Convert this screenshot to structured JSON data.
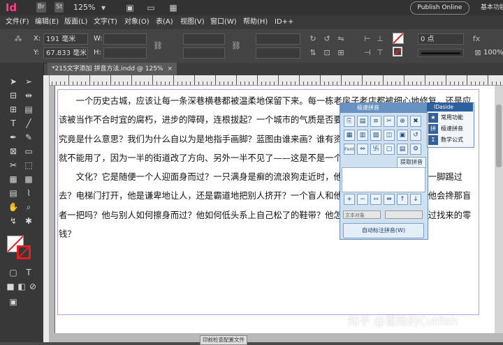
{
  "app": {
    "logo": "Id",
    "bridge": "Br",
    "stock": "St",
    "zoom": "125%",
    "publish": "Publish Online",
    "workspace": "基本功能"
  },
  "menu": [
    "文件(F)",
    "编辑(E)",
    "版面(L)",
    "文字(T)",
    "对象(O)",
    "表(A)",
    "视图(V)",
    "窗口(W)",
    "帮助(H)",
    "ID++"
  ],
  "control": {
    "x_label": "X:",
    "x_value": "191 毫米",
    "y_label": "Y:",
    "y_value": "67.833 毫米",
    "w_label": "W:",
    "h_label": "H:",
    "stroke_weight": "0 点",
    "percent": "100%"
  },
  "tab": {
    "title": "*215文字添加  拼音方法.indd @ 125%",
    "close": "×"
  },
  "document": {
    "paragraphs": [
      "一个历史古城，应该让每一条深巷横巷都被温柔地保留下来。每一栋老房子老店都被细心地修复，还是应该被当作不合时宜的腐朽，进步的障碍，连根拔起？一个城市的气质是否要温柔和细心？而“腐朽”和“进步”又究竟是什么意思？我们为什么自以为是地指手画脚？蓝图由谁来画？谁有资格来画？一张新地图，过了一个月就不能用了，因为一半的街道改了方向、另外一半不见了——这是不是一个城市的幸福所系？",
      "文化？它是随便一个人迎面身而过？一只满身是癣的流浪狗走近时，他是否本能地避开，还是一脚踢过去？电梯门打开，他是谦卑地让人，还是霸道地把别人挤开？一个盲人和他并肩路口，绿灯亮了，他会搀那盲者一把吗？他与别人如何擦身而过？他如何低头系上自己松了的鞋带？他怎么从卖菜的小贩手里接过找来的零钱？"
    ]
  },
  "pinyin_panel": {
    "title": "极速拼音",
    "font_btn": "Font",
    "fetch": "提取拼音",
    "sel1": "文本对象",
    "sel2": "",
    "auto": "自动标注拼音(W)"
  },
  "ida_panel": {
    "title": "IDaside",
    "items": [
      "常用功能",
      "极速拼音",
      "数学公式"
    ]
  },
  "status_tip": "印前检查配置文件",
  "watermark": "知乎 @冒险的Cutfish"
}
